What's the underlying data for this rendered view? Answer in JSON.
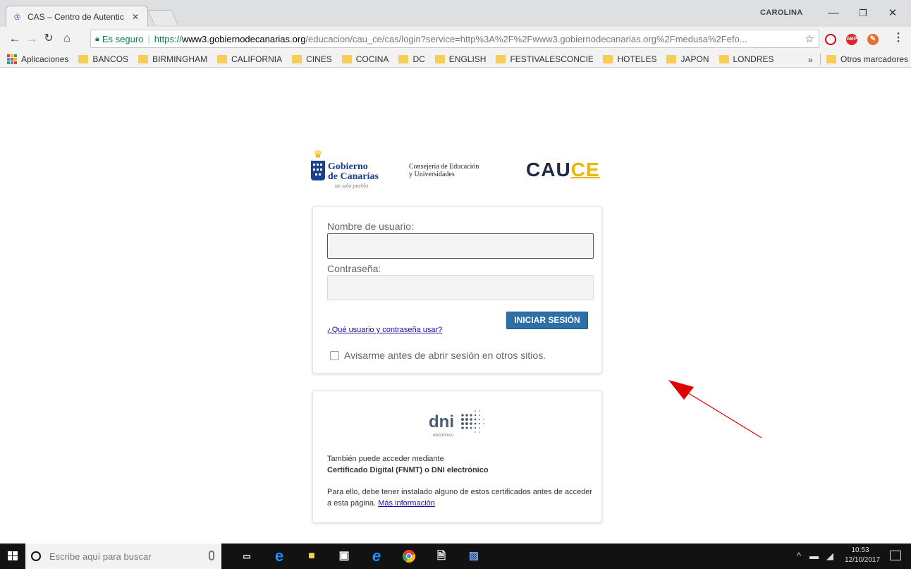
{
  "browser": {
    "tab_title": "CAS – Centro de Autentic",
    "profile": "CAROLINA",
    "url_secure_label": "Es seguro",
    "url_scheme": "https://",
    "url_host": "www3.gobiernodecanarias.org",
    "url_path": "/educacion/cau_ce/cas/login?service=http%3A%2F%2Fwww3.gobiernodecanarias.org%2Fmedusa%2Fefo..."
  },
  "bookmarks": {
    "apps": "Aplicaciones",
    "items": [
      "BANCOS",
      "BIRMINGHAM",
      "CALIFORNIA",
      "CINES",
      "COCINA",
      "DC",
      "ENGLISH",
      "FESTIVALESCONCIERT",
      "HOTELES",
      "JAPON",
      "LONDRES"
    ],
    "overflow": "»",
    "other": "Otros marcadores"
  },
  "header": {
    "gob_line1": "Gobierno",
    "gob_line2": "de Canarias",
    "gob_motto": "un solo pueblo",
    "consejeria_line1": "Consejería de Educación",
    "consejeria_line2": "y Universidades",
    "cauce_a": "CAU",
    "cauce_b": "CE"
  },
  "login": {
    "username_label": "Nombre de usuario:",
    "username_value": "",
    "password_label": "Contraseña:",
    "password_value": "",
    "help_link": "¿Qué usuario y contraseña usar?",
    "submit_label": "INICIAR SESIÓN",
    "warn_label": "Avisarme antes de abrir sesión en otros sitios."
  },
  "certificate": {
    "dni_text": "dni",
    "dni_sub": "electrónico",
    "line1": "También puede acceder mediante",
    "line2": "Certificado Digital (FNMT) o DNI electrónico",
    "para": "Para ello, debe tener instalado alguno de estos certificados antes de acceder a esta página.",
    "more_link": "Más información"
  },
  "taskbar": {
    "search_placeholder": "Escribe aquí para buscar",
    "time": "10:53",
    "date": "12/10/2017"
  },
  "colors": {
    "primary_button": "#2d6fa6",
    "gob_blue": "#1b3f8f",
    "cauce_yellow": "#f0b400",
    "arrow_red": "#e00000"
  }
}
